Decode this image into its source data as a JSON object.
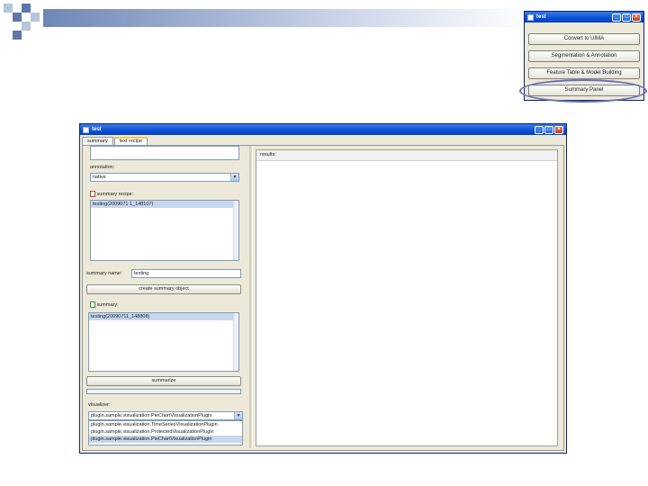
{
  "launcher": {
    "title": "test",
    "buttons": [
      "Convert to UIMA",
      "Segmentation & Annotation",
      "Feature Table & Model Building",
      "Summary Panel"
    ]
  },
  "main": {
    "title": "test",
    "tabs": [
      "summary",
      "text recipe"
    ],
    "annotation_label": "annotation:",
    "annotation_value": "native",
    "summary_recipe_label": "summary recipe:",
    "recipe_items": [
      "testing(2009071 1_148107)"
    ],
    "summary_name_label": "summary name:",
    "summary_name_value": "testing",
    "create_button": "create summary object",
    "summary_label": "summary:",
    "summary_items": [
      "testing(20090711_148808)"
    ],
    "summarize_button": "summarize",
    "visualizer_label": "visualizer:",
    "visualizer_selected": "plugin.sample.visualization.PieChartVisualizationPlugin",
    "visualizer_options": [
      "plugin.sample.visualization.TimeSeriesVisualizationPlugin",
      "plugin.sample.visualization.ProtectedVisualizationPlugin",
      "plugin.sample.visualization.PieChartVisualizationPlugin"
    ],
    "results_label": "results:"
  },
  "colors": {
    "titlebar": "#0a4fd6",
    "highlight_ellipse": "#6670b8",
    "selection": "#c8d6ee"
  }
}
